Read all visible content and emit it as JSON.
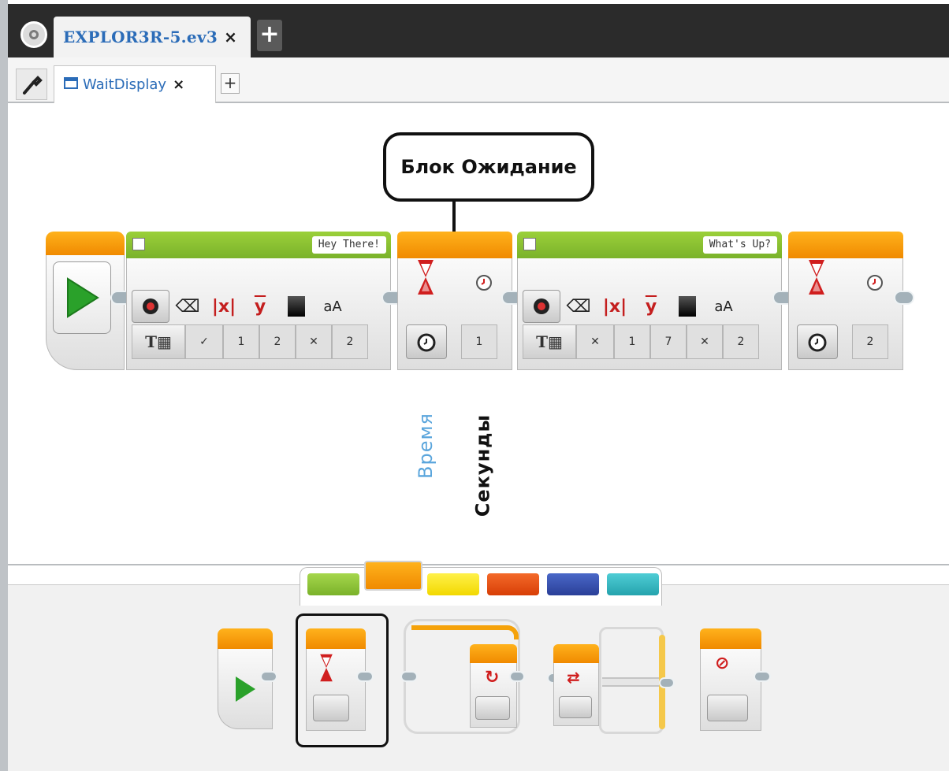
{
  "project_tab": {
    "label": "EXPLOR3R-5.ev3",
    "close": "×",
    "add": "+"
  },
  "program_tab": {
    "label": "WaitDisplay",
    "close": "×",
    "add": "+"
  },
  "callout": {
    "text": "Блок Ожидание"
  },
  "blocks": {
    "display1": {
      "text": "Hey There!",
      "params": [
        "✓",
        "1",
        "2",
        "✕",
        "2"
      ]
    },
    "wait1": {
      "seconds": "1"
    },
    "display2": {
      "text": "What's Up?",
      "params": [
        "✕",
        "1",
        "7",
        "✕",
        "2"
      ]
    },
    "wait2": {
      "seconds": "2"
    }
  },
  "annotations": {
    "mode": "Время",
    "unit": "Секунды"
  },
  "palette": {
    "tabs": [
      {
        "name": "action",
        "color": "#8dc12b"
      },
      {
        "name": "flow",
        "color": "#f59a00"
      },
      {
        "name": "sensor",
        "color": "#f6e100"
      },
      {
        "name": "data",
        "color": "#e04a0d"
      },
      {
        "name": "advanced",
        "color": "#2e49a8"
      },
      {
        "name": "myblocks",
        "color": "#2fb3bd"
      }
    ],
    "active_tab": "flow"
  },
  "colors": {
    "accent_blue": "#2b6cb8",
    "flow_orange": "#f59a00",
    "action_green": "#8dc12b"
  }
}
